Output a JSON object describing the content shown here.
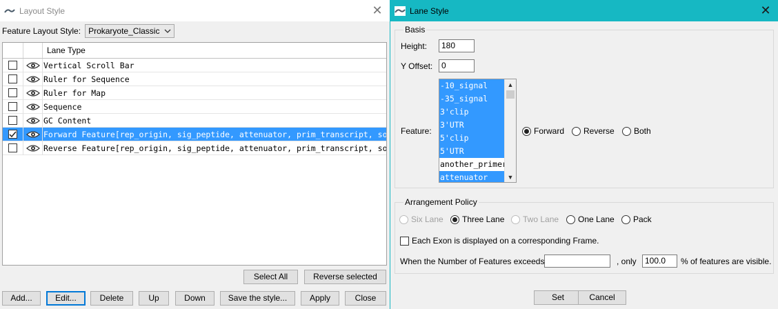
{
  "layout_window": {
    "title": "Layout Style",
    "feature_layout_label": "Feature Layout Style:",
    "feature_layout_value": "Prokaryote_Classic",
    "table_header": "Lane Type",
    "lanes": [
      {
        "label": "Vertical Scroll Bar",
        "checked": false,
        "selected": false
      },
      {
        "label": "Ruler for Sequence",
        "checked": false,
        "selected": false
      },
      {
        "label": "Ruler for Map",
        "checked": false,
        "selected": false
      },
      {
        "label": "Sequence",
        "checked": false,
        "selected": false
      },
      {
        "label": "GC Content",
        "checked": false,
        "selected": false
      },
      {
        "label": "Forward Feature[rep_origin, sig_peptide, attenuator, prim_transcript, source, v...",
        "checked": true,
        "selected": true
      },
      {
        "label": "Reverse Feature[rep_origin, sig_peptide, attenuator, prim_transcript, source, v...",
        "checked": false,
        "selected": false
      }
    ],
    "select_all_label": "Select All",
    "reverse_selected_label": "Reverse selected",
    "add_label": "Add...",
    "edit_label": "Edit...",
    "delete_label": "Delete",
    "up_label": "Up",
    "down_label": "Down",
    "save_style_label": "Save the style...",
    "apply_label": "Apply",
    "close_label": "Close"
  },
  "lane_window": {
    "title": "Lane Style",
    "basis_label": "Basis",
    "height_label": "Height:",
    "height_value": "180",
    "yoffset_label": "Y Offset:",
    "yoffset_value": "0",
    "feature_label": "Feature:",
    "features": [
      {
        "name": "-10_signal",
        "selected": true
      },
      {
        "name": "-35_signal",
        "selected": true
      },
      {
        "name": "3'clip",
        "selected": true
      },
      {
        "name": "3'UTR",
        "selected": true
      },
      {
        "name": "5'clip",
        "selected": true
      },
      {
        "name": "5'UTR",
        "selected": true
      },
      {
        "name": "another_primer",
        "selected": false
      },
      {
        "name": "attenuator",
        "selected": true
      }
    ],
    "direction_forward": "Forward",
    "direction_reverse": "Reverse",
    "direction_both": "Both",
    "direction_selected": "Forward",
    "arrangement_label": "Arrangement Policy",
    "six_lane": "Six Lane",
    "three_lane": "Three Lane",
    "two_lane": "Two Lane",
    "one_lane": "One Lane",
    "pack": "Pack",
    "arrangement_selected": "Three Lane",
    "each_exon_label": "Each Exon is displayed on a corresponding Frame.",
    "each_exon_checked": false,
    "when_number_label": "When the Number of Features exceeds",
    "when_number_value": "",
    "only_label": ", only",
    "percent_value": "100.0",
    "percent_suffix": "% of features are visible.",
    "set_label": "Set",
    "cancel_label": "Cancel"
  }
}
